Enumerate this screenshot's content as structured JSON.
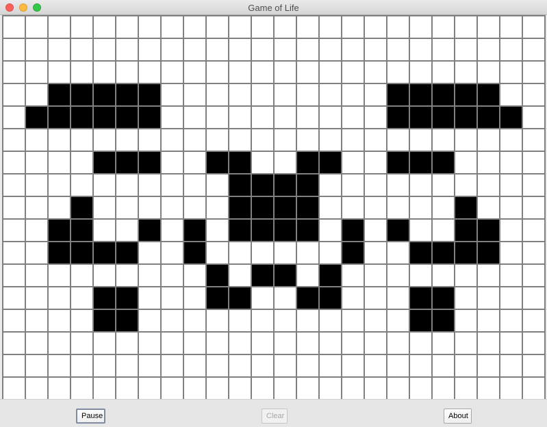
{
  "window": {
    "title": "Game of Life"
  },
  "controls": {
    "pause_label": "Pause",
    "clear_label": "Clear",
    "about_label": "About",
    "clear_enabled": false
  },
  "board": {
    "rows": 17,
    "cols": 24,
    "alive_color": "#000000",
    "dead_color": "#ffffff",
    "gridline_color": "#808080",
    "live_cells": [
      [
        3,
        2
      ],
      [
        3,
        3
      ],
      [
        3,
        4
      ],
      [
        3,
        5
      ],
      [
        3,
        6
      ],
      [
        3,
        17
      ],
      [
        3,
        18
      ],
      [
        3,
        19
      ],
      [
        3,
        20
      ],
      [
        3,
        21
      ],
      [
        4,
        1
      ],
      [
        4,
        2
      ],
      [
        4,
        3
      ],
      [
        4,
        4
      ],
      [
        4,
        5
      ],
      [
        4,
        6
      ],
      [
        4,
        17
      ],
      [
        4,
        18
      ],
      [
        4,
        19
      ],
      [
        4,
        20
      ],
      [
        4,
        21
      ],
      [
        4,
        22
      ],
      [
        6,
        4
      ],
      [
        6,
        5
      ],
      [
        6,
        6
      ],
      [
        6,
        9
      ],
      [
        6,
        10
      ],
      [
        6,
        13
      ],
      [
        6,
        14
      ],
      [
        6,
        17
      ],
      [
        6,
        18
      ],
      [
        6,
        19
      ],
      [
        7,
        10
      ],
      [
        7,
        11
      ],
      [
        7,
        12
      ],
      [
        7,
        13
      ],
      [
        8,
        3
      ],
      [
        8,
        10
      ],
      [
        8,
        11
      ],
      [
        8,
        12
      ],
      [
        8,
        13
      ],
      [
        8,
        20
      ],
      [
        9,
        2
      ],
      [
        9,
        3
      ],
      [
        9,
        6
      ],
      [
        9,
        8
      ],
      [
        9,
        10
      ],
      [
        9,
        11
      ],
      [
        9,
        12
      ],
      [
        9,
        13
      ],
      [
        9,
        15
      ],
      [
        9,
        17
      ],
      [
        9,
        20
      ],
      [
        9,
        21
      ],
      [
        10,
        2
      ],
      [
        10,
        3
      ],
      [
        10,
        4
      ],
      [
        10,
        5
      ],
      [
        10,
        8
      ],
      [
        10,
        15
      ],
      [
        10,
        18
      ],
      [
        10,
        19
      ],
      [
        10,
        20
      ],
      [
        10,
        21
      ],
      [
        11,
        9
      ],
      [
        11,
        11
      ],
      [
        11,
        12
      ],
      [
        11,
        14
      ],
      [
        12,
        4
      ],
      [
        12,
        5
      ],
      [
        12,
        9
      ],
      [
        12,
        10
      ],
      [
        12,
        13
      ],
      [
        12,
        14
      ],
      [
        12,
        18
      ],
      [
        12,
        19
      ],
      [
        13,
        4
      ],
      [
        13,
        5
      ],
      [
        13,
        18
      ],
      [
        13,
        19
      ]
    ]
  }
}
